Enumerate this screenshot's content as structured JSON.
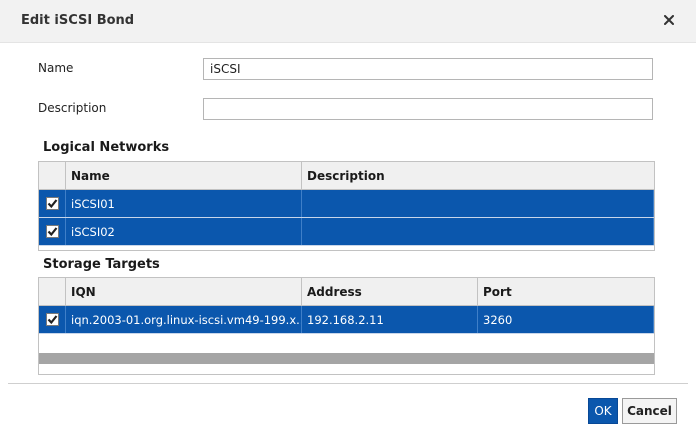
{
  "dialog": {
    "title": "Edit iSCSI Bond",
    "close_symbol": "×"
  },
  "form": {
    "name_label": "Name",
    "name_value": "iSCSI",
    "description_label": "Description",
    "description_value": ""
  },
  "logical_networks": {
    "heading": "Logical Networks",
    "columns": [
      "Name",
      "Description"
    ],
    "rows": [
      {
        "checked": true,
        "name": "iSCSI01",
        "description": ""
      },
      {
        "checked": true,
        "name": "iSCSI02",
        "description": ""
      }
    ]
  },
  "storage_targets": {
    "heading": "Storage Targets",
    "columns": [
      "IQN",
      "Address",
      "Port"
    ],
    "rows": [
      {
        "checked": true,
        "iqn": "iqn.2003-01.org.linux-iscsi.vm49-199.x...",
        "address": "192.168.2.11",
        "port": "3260"
      }
    ]
  },
  "footer": {
    "ok_label": "OK",
    "cancel_label": "Cancel"
  },
  "colors": {
    "selection": "#0b57ad",
    "titlebar": "#f2f2f2",
    "scrollbar": "#a5a5a5"
  }
}
